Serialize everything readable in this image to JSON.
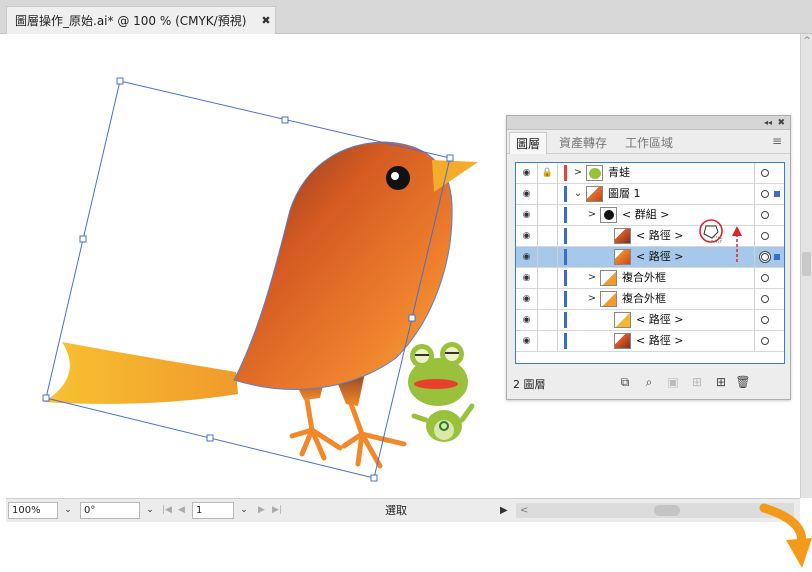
{
  "document_tab": {
    "title": "圖層操作_原始.ai* @ 100 % (CMYK/預視)",
    "close": "✖"
  },
  "status_bar": {
    "zoom": "100%",
    "rotation": "0°",
    "artboard": "1",
    "tool": "選取",
    "dropdown": "⌄",
    "nav_first": "|◀",
    "nav_prev": "◀",
    "nav_next": "▶",
    "nav_last": "▶|",
    "play": "▶",
    "scroll_left": "<"
  },
  "scrollbar": {
    "up": "^"
  },
  "layers_panel": {
    "collapse": "◂◂",
    "close": "✖",
    "tabs": [
      {
        "label": "圖層",
        "active": true
      },
      {
        "label": "資產轉存",
        "active": false
      },
      {
        "label": "工作區域",
        "active": false
      }
    ],
    "menu": "≡",
    "rows": [
      {
        "name": "青蛙",
        "lock": "🔒",
        "twist": ">",
        "eye": "◉",
        "stripe": "#e0443a",
        "thumb": "frog",
        "selected": false,
        "target_square": false
      },
      {
        "name": "圖層 1",
        "lock": "",
        "twist": "⌄",
        "eye": "◉",
        "stripe": "#3a6cc8",
        "thumb": "bird",
        "selected": false,
        "target_square": true
      },
      {
        "name": "< 群組 >",
        "lock": "",
        "twist": ">",
        "eye": "◉",
        "stripe": "#3a6cc8",
        "thumb": "eye",
        "selected": false,
        "target_square": false
      },
      {
        "name": "< 路徑 >",
        "lock": "",
        "twist": "",
        "eye": "◉",
        "stripe": "#3a6cc8",
        "thumb": "wing",
        "selected": false,
        "target_square": false
      },
      {
        "name": "< 路徑 >",
        "lock": "",
        "twist": "",
        "eye": "◉",
        "stripe": "#3a6cc8",
        "thumb": "body",
        "selected": true,
        "target_square": true
      },
      {
        "name": "複合外框",
        "lock": "",
        "twist": ">",
        "eye": "◉",
        "stripe": "#3a6cc8",
        "thumb": "legs",
        "selected": false,
        "target_square": false
      },
      {
        "name": "複合外框",
        "lock": "",
        "twist": ">",
        "eye": "◉",
        "stripe": "#3a6cc8",
        "thumb": "legs",
        "selected": false,
        "target_square": false
      },
      {
        "name": "< 路徑 >",
        "lock": "",
        "twist": "",
        "eye": "◉",
        "stripe": "#3a6cc8",
        "thumb": "tail",
        "selected": false,
        "target_square": false
      },
      {
        "name": "< 路徑 >",
        "lock": "",
        "twist": "",
        "eye": "◉",
        "stripe": "#3a6cc8",
        "thumb": "wing",
        "selected": false,
        "target_square": false
      }
    ],
    "footer": {
      "count": "2 圖層",
      "icons": [
        "export-icon",
        "search-icon",
        "clipping-mask-icon",
        "new-sublayer-icon",
        "new-layer-icon",
        "trash-icon"
      ]
    }
  },
  "colors": {
    "accent": "#3a7bd5",
    "selection": "#a6c8ea",
    "bird_dark": "#8a3a1e",
    "bird_orange": "#e8702a",
    "tail_yellow": "#f4b532",
    "frog_green": "#9ac13c",
    "annotation_red": "#e0232a",
    "arrow_orange": "#f39a1a"
  }
}
